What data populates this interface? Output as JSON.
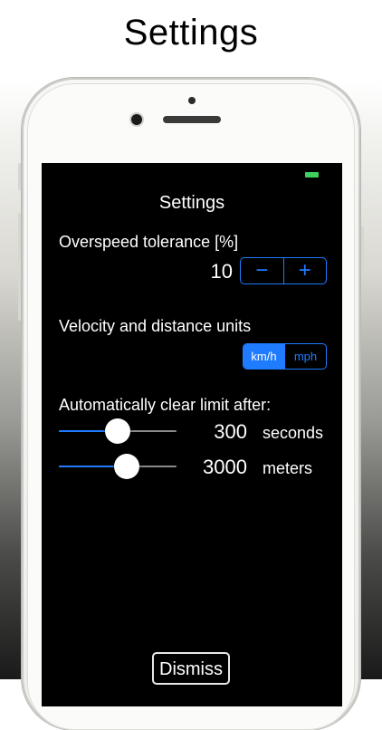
{
  "headline": "Settings",
  "screen": {
    "title": "Settings",
    "overspeed": {
      "label": "Overspeed tolerance [%]",
      "value": "10",
      "decrement": "−",
      "increment": "+"
    },
    "units": {
      "label": "Velocity and distance units",
      "options": [
        "km/h",
        "mph"
      ],
      "selected": "km/h"
    },
    "auto_clear": {
      "label": "Automatically clear limit after:",
      "seconds": {
        "value": "300",
        "unit": "seconds",
        "level": 0.5
      },
      "meters": {
        "value": "3000",
        "unit": "meters",
        "level": 0.58
      }
    },
    "dismiss_label": "Dismiss"
  },
  "colors": {
    "accent": "#1f7bff",
    "battery": "#3ecf5c",
    "screen_bg": "#000000"
  }
}
